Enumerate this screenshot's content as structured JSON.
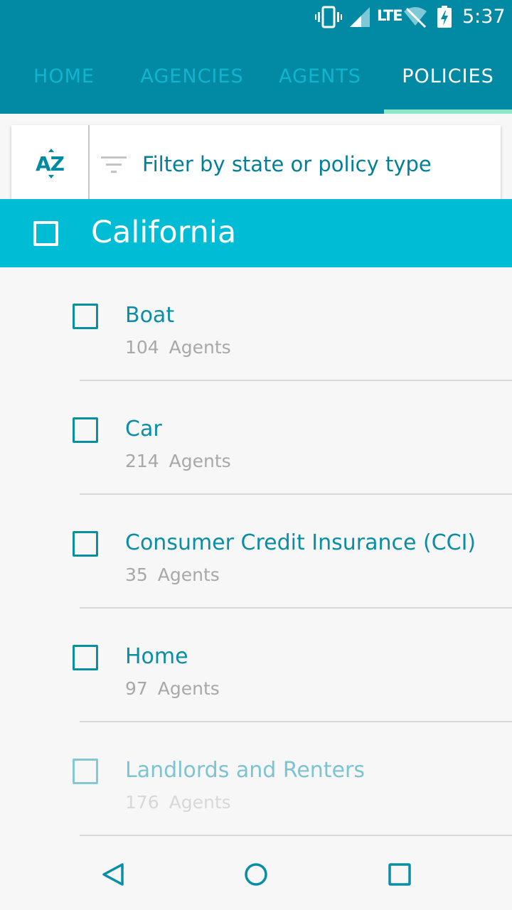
{
  "status_bar": {
    "network": "LTE",
    "time": "5:37",
    "icons": [
      "vibrate-icon",
      "signal-icon",
      "wifi-off-icon",
      "battery-charging-icon"
    ]
  },
  "tabs": [
    {
      "label": "HOME",
      "active": false
    },
    {
      "label": "AGENCIES",
      "active": false
    },
    {
      "label": "AGENTS",
      "active": false
    },
    {
      "label": "POLICIES",
      "active": true
    }
  ],
  "toolbar": {
    "sort_icon": "sort-az-icon",
    "sort_label": "AZ",
    "filter_icon": "filter-icon",
    "filter_placeholder": "Filter by state or policy type"
  },
  "section": {
    "title": "California",
    "checked": false
  },
  "items": [
    {
      "title": "Boat",
      "count": "104",
      "unit": "Agents",
      "checked": false
    },
    {
      "title": "Car",
      "count": "214",
      "unit": "Agents",
      "checked": false
    },
    {
      "title": "Consumer Credit Insurance (CCI)",
      "count": "35",
      "unit": "Agents",
      "checked": false
    },
    {
      "title": "Home",
      "count": "97",
      "unit": "Agents",
      "checked": false
    },
    {
      "title": "Landlords and Renters",
      "count": "176",
      "unit": "Agents",
      "checked": false
    }
  ],
  "colors": {
    "app_bar": "#028aa4",
    "tab_inactive": "#11b4cf",
    "tab_indicator": "#8de8c8",
    "section_header": "#00bcd4",
    "accent_text": "#0a8ea6",
    "secondary_text": "#a8a8a8",
    "background": "#f7f7f7"
  },
  "nav_bar": {
    "buttons": [
      "back-icon",
      "home-circle-icon",
      "recents-square-icon"
    ]
  }
}
